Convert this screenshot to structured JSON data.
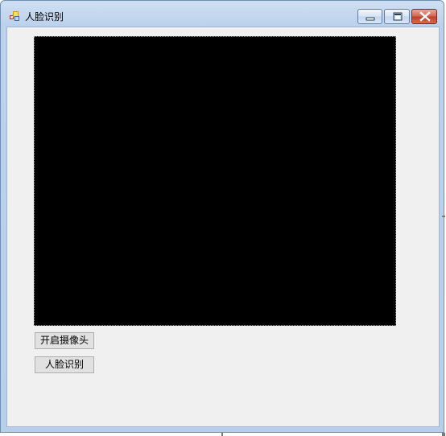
{
  "window": {
    "title": "人脸识别",
    "icon": "app-form-icon"
  },
  "titlebar_controls": {
    "minimize_icon": "minimize-icon",
    "maximize_icon": "maximize-icon",
    "close_icon": "close-icon"
  },
  "video": {
    "background": "#000000"
  },
  "buttons": {
    "open_camera": "开启摄像头",
    "recognize": "人脸识别"
  },
  "colors": {
    "close_button": "#c1412b",
    "client_background": "#f0f0f0"
  }
}
